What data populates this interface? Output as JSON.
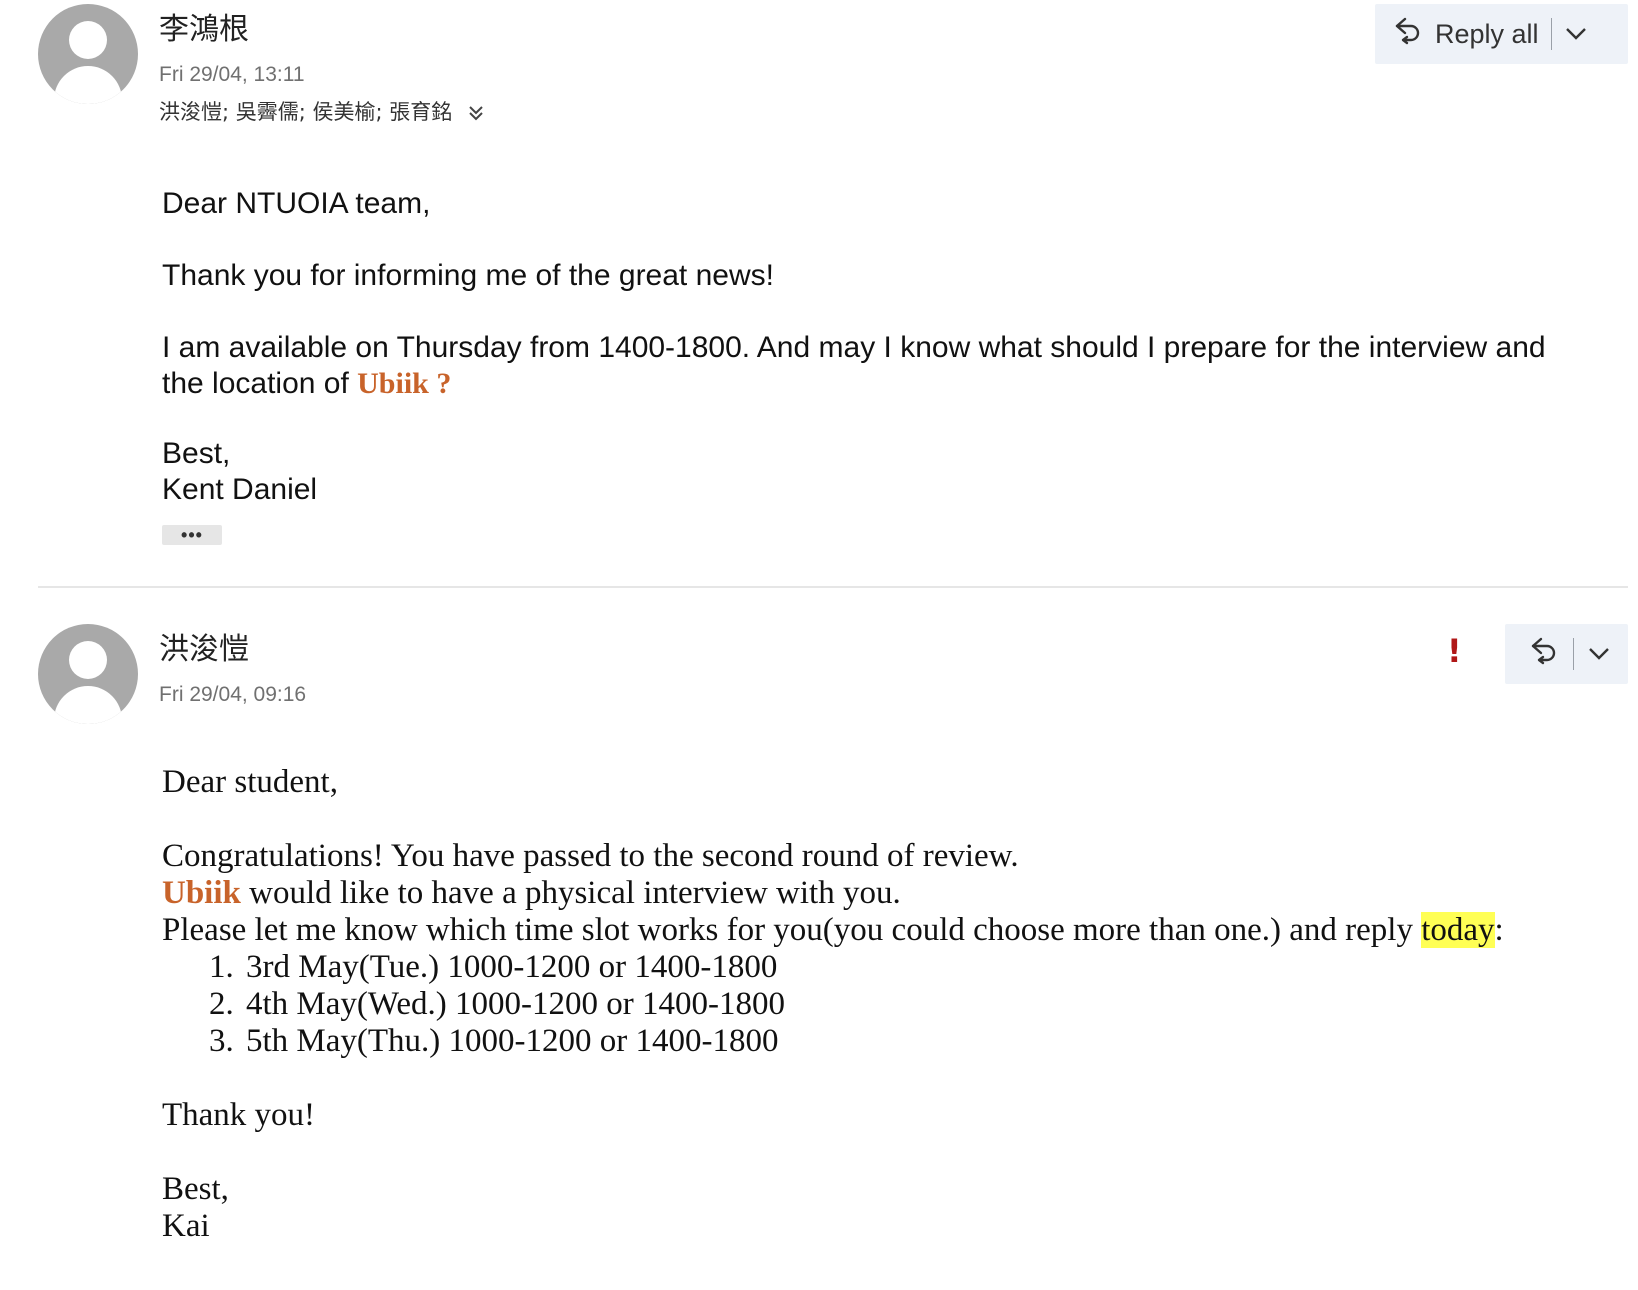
{
  "message1": {
    "sender": "李鴻根",
    "date": "Fri 29/04, 13:11",
    "recipients": "洪浚愷; 吳霽儒; 侯美榆; 張育銘",
    "reply_all_label": "Reply all",
    "body": {
      "greeting": "Dear NTUOIA team,",
      "line1": "Thank you for informing me of the great news!",
      "line2_before": "I am available on Thursday from 1400-1800. And may I know what should I prepare for the interview and the location of ",
      "brand": "Ubiik",
      "line2_after": " ?",
      "signoff": "Best,",
      "signature": "Kent Daniel"
    },
    "ellipsis": "•••"
  },
  "message2": {
    "sender": "洪浚愷",
    "date": "Fri 29/04, 09:16",
    "importance": "!",
    "body": {
      "greeting": "Dear student,",
      "line1": "Congratulations! You have passed to the second round of review.",
      "brand": "Ubiik",
      "line2_after": " would like to have a physical interview with you.",
      "line3_before": "Please let me know which time slot works for you(you could choose more than one.) and reply ",
      "line3_highlight": "today",
      "line3_after": ":",
      "slots": [
        "3rd May(Tue.) 1000-1200 or 1400-1800",
        "4th May(Wed.) 1000-1200 or 1400-1800",
        "5th May(Thu.) 1000-1200 or 1400-1800"
      ],
      "thanks": "Thank you!",
      "signoff": "Best,",
      "signature": "Kai"
    }
  },
  "colors": {
    "brand": "#c8632a",
    "highlight": "#ffff55",
    "importance": "#b01818",
    "button_bg": "#eef2f8"
  }
}
